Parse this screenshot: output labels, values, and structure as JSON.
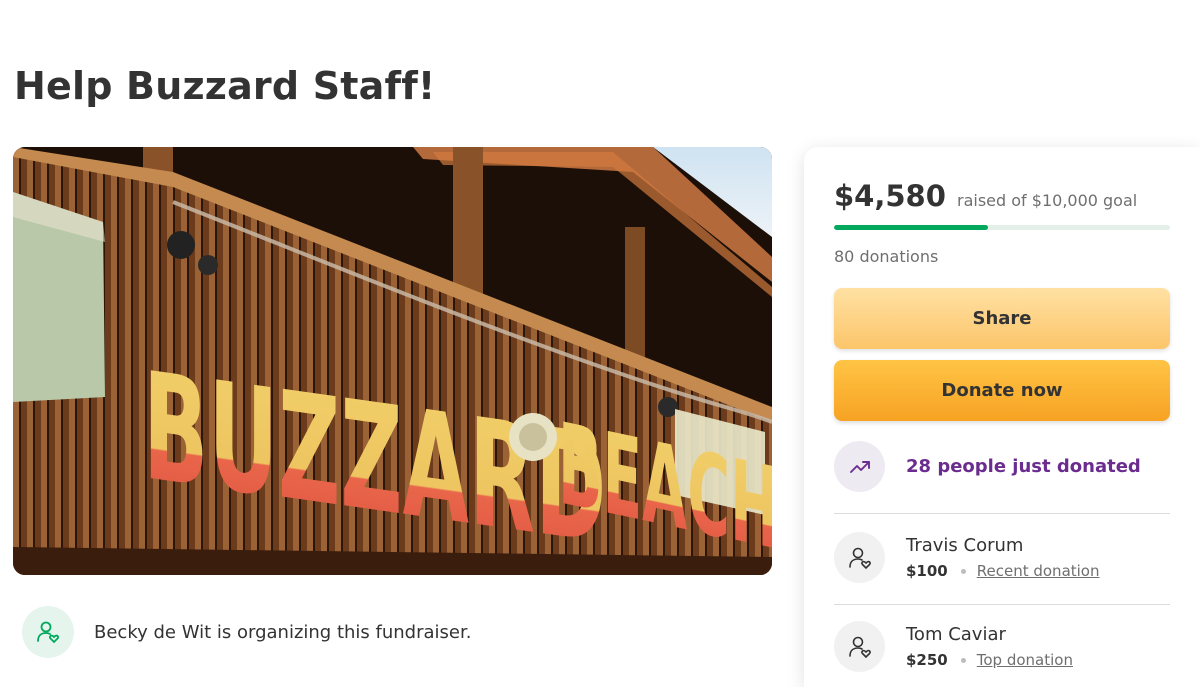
{
  "campaign": {
    "title": "Help Buzzard Staff!"
  },
  "hero": {
    "sign_line1": "BUZZARD",
    "sign_line2": "BEACH"
  },
  "organizer": {
    "icon": "person-heart-icon",
    "text": "Becky de Wit is organizing this fundraiser."
  },
  "donation": {
    "raised_amount": "$4,580",
    "goal_text": "raised of $10,000 goal",
    "progress_fraction": 0.458,
    "donation_count": "80 donations",
    "share_label": "Share",
    "donate_label": "Donate now",
    "trend_icon": "trending-up-icon",
    "trend_text": "28 people just donated",
    "donors": [
      {
        "name": "Travis Corum",
        "amount": "$100",
        "tag": "Recent donation",
        "icon": "person-heart-icon"
      },
      {
        "name": "Tom Caviar",
        "amount": "$250",
        "tag": "Top donation",
        "icon": "person-heart-icon"
      }
    ]
  },
  "colors": {
    "accent_green": "#02a95c",
    "trend_purple": "#6b2c8f",
    "donate_orange": "#f7a223",
    "share_yellow": "#fcc56a"
  }
}
